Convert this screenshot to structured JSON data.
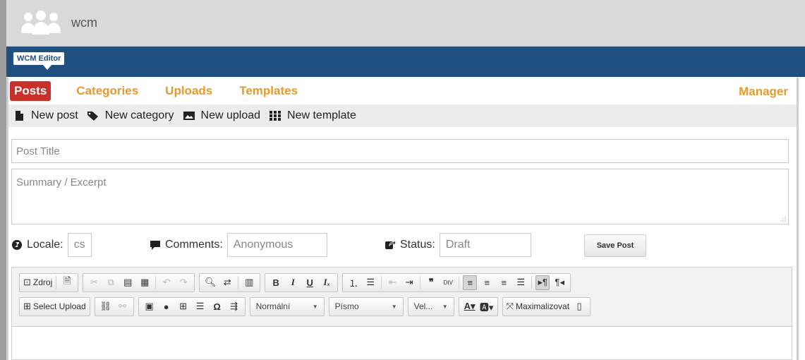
{
  "app": {
    "name": "wcm",
    "badge": "WCM Editor"
  },
  "nav": {
    "tabs": [
      {
        "label": "Posts",
        "active": true
      },
      {
        "label": "Categories",
        "active": false
      },
      {
        "label": "Uploads",
        "active": false
      },
      {
        "label": "Templates",
        "active": false
      }
    ],
    "manager": "Manager"
  },
  "actions": [
    {
      "label": "New post",
      "icon": "file-icon"
    },
    {
      "label": "New category",
      "icon": "tags-icon"
    },
    {
      "label": "New upload",
      "icon": "image-icon"
    },
    {
      "label": "New template",
      "icon": "grid-icon"
    }
  ],
  "form": {
    "title_placeholder": "Post Title",
    "summary_placeholder": "Summary / Excerpt",
    "locale_label": "Locale:",
    "locale_value": "cs",
    "comments_label": "Comments:",
    "comments_value": "Anonymous",
    "status_label": "Status:",
    "status_value": "Draft",
    "save_label": "Save Post"
  },
  "toolbar": {
    "source": "Zdroj",
    "select_upload": "Select Upload",
    "format": "Normální",
    "font": "Písmo",
    "size": "Vel...",
    "maximize": "Maximalizovat"
  },
  "colors": {
    "accent": "#e59a2b",
    "active_tab": "#c8312b",
    "band": "#1f5080"
  }
}
